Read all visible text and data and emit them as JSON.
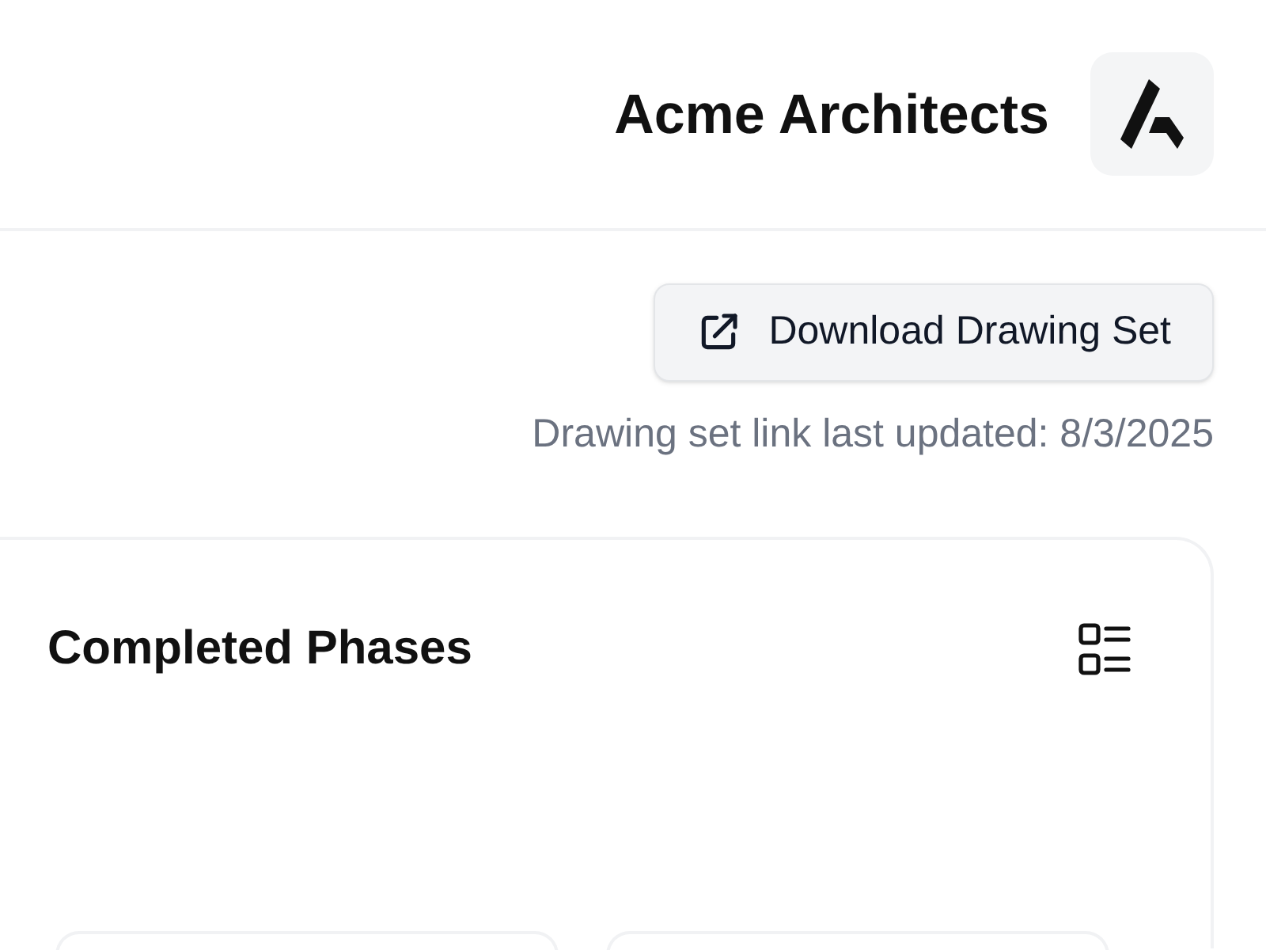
{
  "header": {
    "company_name": "Acme Architects"
  },
  "download": {
    "button_label": "Download Drawing Set",
    "updated_note": "Drawing set link last updated: 8/3/2025"
  },
  "completed_phases": {
    "title": "Completed Phases"
  }
}
